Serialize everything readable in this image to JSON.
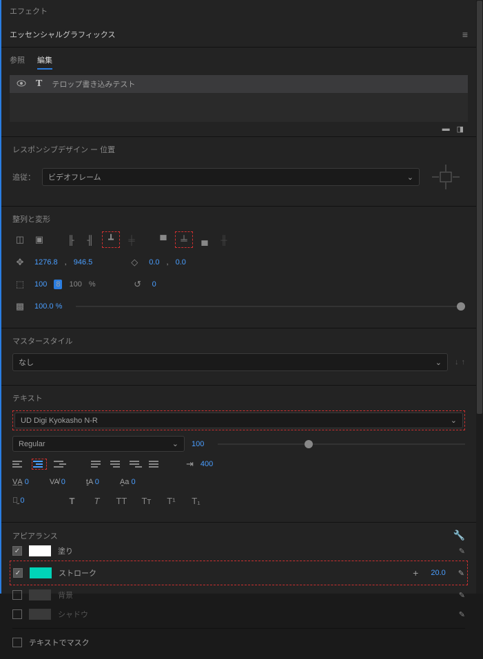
{
  "tabs": {
    "effects": "エフェクト"
  },
  "panel": {
    "title": "エッセンシャルグラフィックス"
  },
  "subtabs": {
    "browse": "参照",
    "edit": "編集"
  },
  "layer": {
    "name": "テロップ書き込みテスト"
  },
  "responsive": {
    "title": "レスポンシブデザイン ー 位置",
    "follow_label": "追従：",
    "follow_value": "ビデオフレーム"
  },
  "align": {
    "title": "整列と変形"
  },
  "transform": {
    "pos_x": "1276.8",
    "pos_y": "946.5",
    "anchor_x": "0.0",
    "anchor_y": "0.0",
    "scale1": "100",
    "scale2": "100",
    "pct": "%",
    "rotation": "0",
    "opacity": "100.0 %"
  },
  "master": {
    "title": "マスタースタイル",
    "value": "なし"
  },
  "text": {
    "title": "テキスト",
    "font": "UD Digi Kyokasho N-R",
    "style": "Regular",
    "size": "100",
    "tracking": "400",
    "v1": "0",
    "v2": "0",
    "v3": "0",
    "v4": "0",
    "v5": "0"
  },
  "appear": {
    "title": "アピアランス",
    "fill": "塗り",
    "stroke": "ストローク",
    "stroke_val": "20.0",
    "bg": "背景",
    "shadow": "シャドウ",
    "mask": "テキストでマスク"
  }
}
